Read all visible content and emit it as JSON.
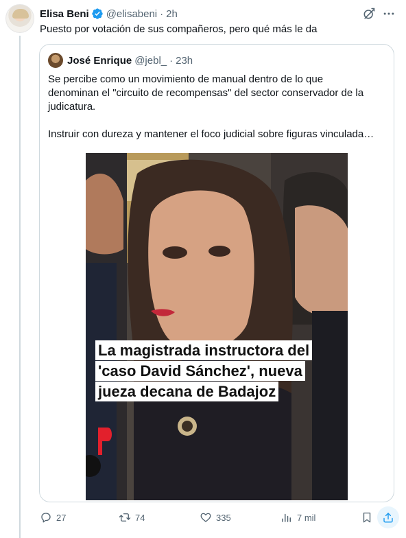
{
  "tweet": {
    "author_name": "Elisa Beni",
    "author_handle": "@elisabeni",
    "separator": "·",
    "time": "2h",
    "text": "Puesto por votación de sus compañeros, pero qué más le da"
  },
  "quote": {
    "author_name": "José Enrique",
    "author_handle": "@jebl_",
    "separator": "·",
    "time": "23h",
    "paragraphs": [
      [
        "Se percibe como un movimiento de manual dentro de lo que",
        "denominan el \"circuito de recompensas\" del sector conservador de la",
        "judicatura."
      ],
      [
        "Instruir con dureza y mantener el foco judicial sobre figuras vinculada…"
      ]
    ],
    "image_caption": [
      "La magistrada instructora del",
      "'caso David Sánchez', nueva",
      "jueza decana de Badajoz"
    ]
  },
  "actions": {
    "replies": "27",
    "reposts": "74",
    "likes": "335",
    "views": "7 mil"
  },
  "colors": {
    "accent": "#1d9bf0",
    "muted": "#536471",
    "border": "#cfd9de",
    "text": "#0f1419"
  },
  "icons": [
    "verified-badge-icon",
    "grok-icon",
    "more-icon",
    "reply-icon",
    "repost-icon",
    "like-icon",
    "views-icon",
    "bookmark-icon",
    "share-icon"
  ]
}
